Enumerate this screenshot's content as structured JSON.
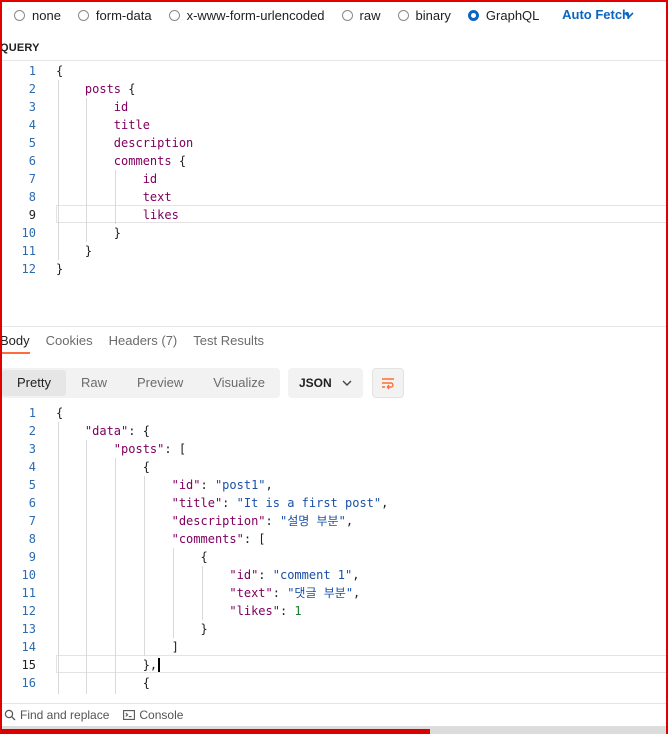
{
  "body_types": {
    "options": [
      {
        "label": "none",
        "selected": false
      },
      {
        "label": "form-data",
        "selected": false
      },
      {
        "label": "x-www-form-urlencoded",
        "selected": false
      },
      {
        "label": "raw",
        "selected": false
      },
      {
        "label": "binary",
        "selected": false
      },
      {
        "label": "GraphQL",
        "selected": true
      }
    ],
    "auto_fetch_label": "Auto Fetch"
  },
  "query": {
    "title": "QUERY",
    "line_numbers": [
      "1",
      "2",
      "3",
      "4",
      "5",
      "6",
      "7",
      "8",
      "9",
      "10",
      "11",
      "12"
    ],
    "active_line": "9"
  },
  "response": {
    "tabs": [
      {
        "label": "Body",
        "active": true
      },
      {
        "label": "Cookies",
        "active": false
      },
      {
        "label": "Headers (7)",
        "active": false
      },
      {
        "label": "Test Results",
        "active": false
      }
    ],
    "view_modes": [
      "Pretty",
      "Raw",
      "Preview",
      "Visualize"
    ],
    "active_view": "Pretty",
    "format": "JSON",
    "line_numbers": [
      "1",
      "2",
      "3",
      "4",
      "5",
      "6",
      "7",
      "8",
      "9",
      "10",
      "11",
      "12",
      "13",
      "14",
      "15",
      "16"
    ],
    "active_line": "15",
    "values": {
      "post_id": "\"post1\"",
      "post_title": "\"It is a first post\"",
      "post_description": "\"설명 부분\"",
      "comment_id": "\"comment 1\"",
      "comment_text": "\"댓글 부분\"",
      "comment_likes": "1"
    }
  },
  "statusbar": {
    "find_replace": "Find and replace",
    "console": "Console"
  },
  "colors": {
    "accent": "#0b66c2",
    "tab_underline": "#ff6c37",
    "frame": "#e00000"
  }
}
